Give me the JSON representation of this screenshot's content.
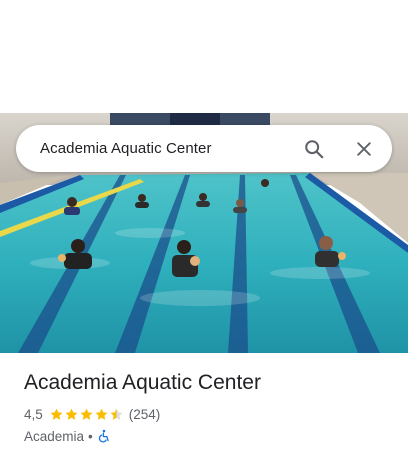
{
  "search": {
    "query": "Academia Aquatic Center"
  },
  "photo": {
    "icon": "pool-photo"
  },
  "place": {
    "name": "Academia Aquatic Center",
    "rating": "4,5",
    "rating_value": 4.5,
    "review_count": "(254)",
    "category": "Academia",
    "separator": "•",
    "accessibility_icon": "wheelchair-icon"
  },
  "colors": {
    "star": "#fbbc04",
    "star_empty": "#dadce0",
    "accessible": "#1a73e8",
    "text_primary": "#202124",
    "text_secondary": "#5f6368"
  }
}
